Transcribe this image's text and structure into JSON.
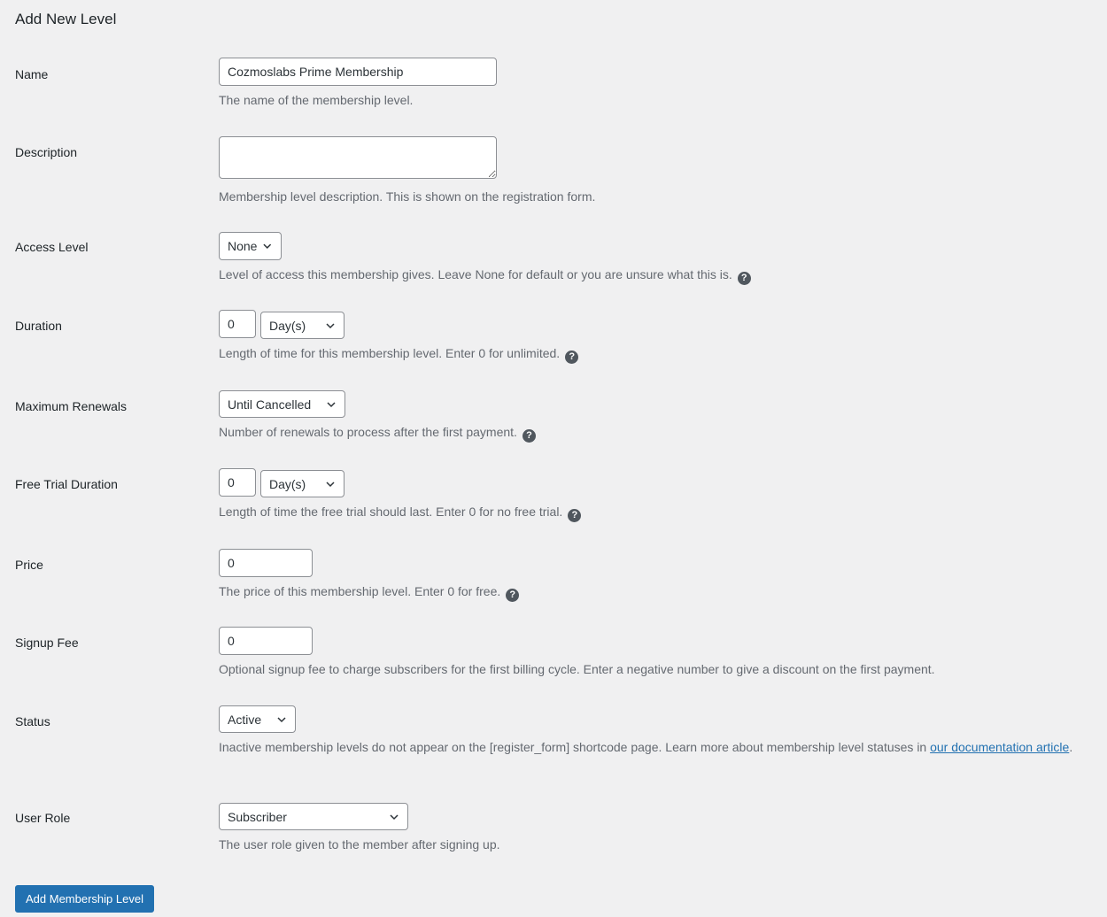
{
  "page": {
    "title": "Add New Level"
  },
  "fields": {
    "name": {
      "label": "Name",
      "value": "Cozmoslabs Prime Membership",
      "description": "The name of the membership level."
    },
    "description": {
      "label": "Description",
      "value": "",
      "description": "Membership level description. This is shown on the registration form."
    },
    "access_level": {
      "label": "Access Level",
      "selected": "None",
      "description": "Level of access this membership gives. Leave None for default or you are unsure what this is."
    },
    "duration": {
      "label": "Duration",
      "value": "0",
      "unit": "Day(s)",
      "description": "Length of time for this membership level. Enter 0 for unlimited."
    },
    "max_renewals": {
      "label": "Maximum Renewals",
      "selected": "Until Cancelled",
      "description": "Number of renewals to process after the first payment."
    },
    "free_trial": {
      "label": "Free Trial Duration",
      "value": "0",
      "unit": "Day(s)",
      "description": "Length of time the free trial should last. Enter 0 for no free trial."
    },
    "price": {
      "label": "Price",
      "value": "0",
      "description": "The price of this membership level. Enter 0 for free."
    },
    "signup_fee": {
      "label": "Signup Fee",
      "value": "0",
      "description": "Optional signup fee to charge subscribers for the first billing cycle. Enter a negative number to give a discount on the first payment."
    },
    "status": {
      "label": "Status",
      "selected": "Active",
      "description": "Inactive membership levels do not appear on the [register_form] shortcode page. Learn more about membership level statuses in ",
      "link_text": "our documentation article",
      "description_end": "."
    },
    "user_role": {
      "label": "User Role",
      "selected": "Subscriber",
      "description": "The user role given to the member after signing up."
    }
  },
  "help_icon": "?",
  "submit": {
    "label": "Add Membership Level"
  },
  "colors": {
    "primary": "#2271b1",
    "background": "#f0f0f1",
    "help_icon": "#50575e"
  }
}
